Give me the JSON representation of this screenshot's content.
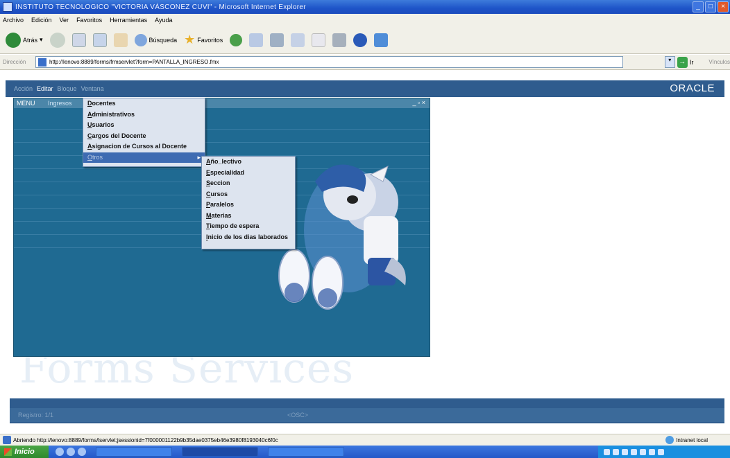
{
  "window": {
    "title": "INSTITUTO TECNOLOGICO \"VICTORIA VÁSCONEZ CUVI\" - Microsoft Internet Explorer"
  },
  "ie_menu": [
    "Archivo",
    "Edición",
    "Ver",
    "Favoritos",
    "Herramientas",
    "Ayuda"
  ],
  "toolbar": {
    "back_label": "Atrás",
    "search_label": "Búsqueda",
    "favorites_label": "Favoritos"
  },
  "address": {
    "label": "Dirección",
    "url": "http://lenovo:8889/forms/frmservlet?form=PANTALLA_INGRESO.fmx",
    "go_label": "Ir",
    "links_label": "Vínculos"
  },
  "forms": {
    "menu": [
      "Acción",
      "Editar",
      "Bloque",
      "Ventana"
    ],
    "active_menu_index": 1,
    "logo": "ORACLE",
    "mdi_title": "MENU",
    "menu_head": "Ingresos",
    "submenu1": [
      "Docentes",
      "Administrativos",
      "Usuarios",
      "Cargos del Docente",
      "Asignacion de Cursos al Docente",
      "Otros"
    ],
    "submenu1_selected": 5,
    "submenu2": [
      "Año_lectivo",
      "Especialidad",
      "Seccion",
      "Cursos",
      "Paralelos",
      "Materias",
      "Tiempo de espera",
      "Inicio de los dias laborados"
    ],
    "watermark": "Forms Services",
    "status_record": "Registro: 1/1",
    "status_osc": "<OSC>"
  },
  "ie_status": {
    "text": "Abriendo http://lenovo:8889/forms/lservlet;jsessionid=7f000001122b9b35dae0375eb46e3980f8193040c6f0c",
    "zone": "Intranet local"
  },
  "taskbar": {
    "start_label": "Inicio"
  }
}
